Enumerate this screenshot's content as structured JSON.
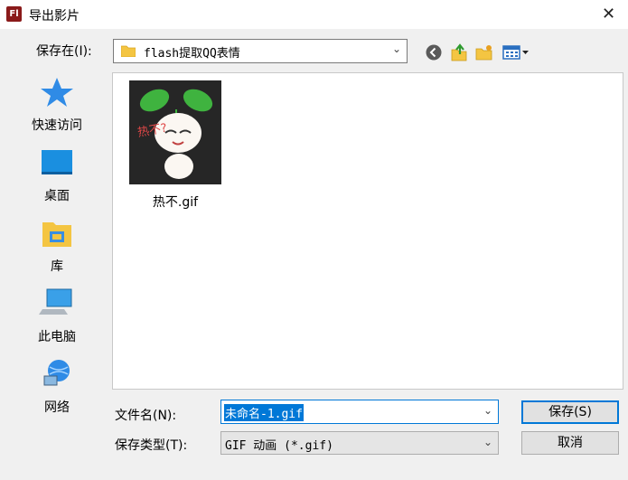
{
  "window": {
    "title": "导出影片",
    "app_icon_text": "Fl",
    "close_glyph": "✕"
  },
  "save_in": {
    "label": "保存在(I):",
    "value": "flash提取QQ表情"
  },
  "places": [
    {
      "label": "快速访问",
      "icon": "star-icon"
    },
    {
      "label": "桌面",
      "icon": "desktop-icon"
    },
    {
      "label": "库",
      "icon": "library-icon"
    },
    {
      "label": "此电脑",
      "icon": "computer-icon"
    },
    {
      "label": "网络",
      "icon": "network-icon"
    }
  ],
  "files": [
    {
      "name": "热不.gif",
      "sticker_text": "热不?"
    }
  ],
  "filename": {
    "label": "文件名(N):",
    "value": "未命名-1.gif"
  },
  "filetype": {
    "label": "保存类型(T):",
    "value": "GIF 动画 (*.gif)"
  },
  "buttons": {
    "save": "保存(S)",
    "cancel": "取消"
  },
  "colors": {
    "accent": "#0078d7",
    "title_bar": "#ffffff",
    "body": "#f0f0f0"
  }
}
